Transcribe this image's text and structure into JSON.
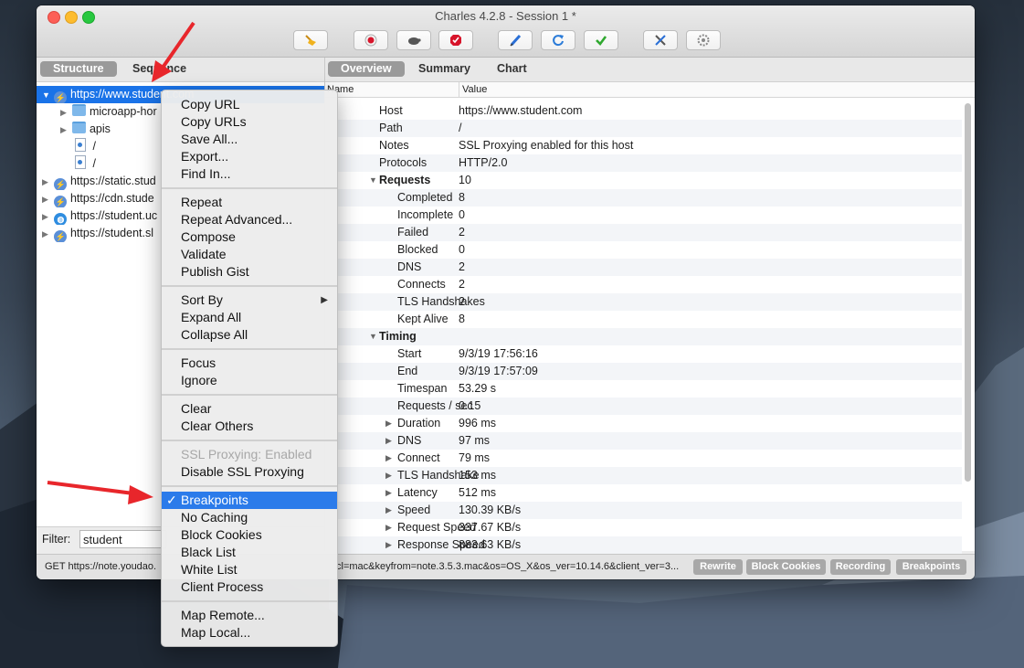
{
  "window": {
    "title": "Charles 4.2.8 - Session 1 *"
  },
  "left_tabs": [
    {
      "label": "Structure"
    },
    {
      "label": "Sequence"
    }
  ],
  "tree": [
    {
      "label": "https://www.student.com",
      "icon": "bolt-icon"
    },
    {
      "label": "microapp-hor",
      "icon": "folder-icon"
    },
    {
      "label": "apis",
      "icon": "folder-icon"
    },
    {
      "label": "/",
      "icon": "document-icon"
    },
    {
      "label": "/",
      "icon": "document-icon"
    },
    {
      "label": "https://static.stud",
      "icon": "bolt-icon"
    },
    {
      "label": "https://cdn.stude",
      "icon": "bolt-icon"
    },
    {
      "label": "https://student.uc",
      "icon": "globe-icon"
    },
    {
      "label": "https://student.sl",
      "icon": "bolt-icon"
    }
  ],
  "filter": {
    "label": "Filter:",
    "value": "student"
  },
  "right_tabs": [
    {
      "label": "Overview"
    },
    {
      "label": "Summary"
    },
    {
      "label": "Chart"
    }
  ],
  "columns": {
    "name": "Name",
    "value": "Value"
  },
  "overview": [
    {
      "name": "Host",
      "value": "https://www.student.com"
    },
    {
      "name": "Path",
      "value": "/"
    },
    {
      "name": "Notes",
      "value": "SSL Proxying enabled for this host"
    },
    {
      "name": "Protocols",
      "value": "HTTP/2.0"
    },
    {
      "name": "Requests",
      "value": "10"
    },
    {
      "name": "Completed",
      "value": "8"
    },
    {
      "name": "Incomplete",
      "value": "0"
    },
    {
      "name": "Failed",
      "value": "2"
    },
    {
      "name": "Blocked",
      "value": "0"
    },
    {
      "name": "DNS",
      "value": "2"
    },
    {
      "name": "Connects",
      "value": "2"
    },
    {
      "name": "TLS Handshakes",
      "value": "2"
    },
    {
      "name": "Kept Alive",
      "value": "8"
    },
    {
      "name": "Timing",
      "value": ""
    },
    {
      "name": "Start",
      "value": "9/3/19 17:56:16"
    },
    {
      "name": "End",
      "value": "9/3/19 17:57:09"
    },
    {
      "name": "Timespan",
      "value": "53.29 s"
    },
    {
      "name": "Requests / sec",
      "value": "0.15"
    },
    {
      "name": "Duration",
      "value": "996 ms"
    },
    {
      "name": "DNS",
      "value": "97 ms"
    },
    {
      "name": "Connect",
      "value": "79 ms"
    },
    {
      "name": "TLS Handshake",
      "value": "153 ms"
    },
    {
      "name": "Latency",
      "value": "512 ms"
    },
    {
      "name": "Speed",
      "value": "130.39 KB/s"
    },
    {
      "name": "Request Speed",
      "value": "337.67 KB/s"
    },
    {
      "name": "Response Speed",
      "value": "883.63 KB/s"
    }
  ],
  "status": {
    "text": "GET https://note.youdao.com/yws/api/personal/sync?method=push&keyfrom=note.3.5.3.mac&os=OS_X&os_ver=10.14.6&client_ver=3...",
    "text_left": "GET https://note.youdao.",
    "text_right": "cl=mac&keyfrom=note.3.5.3.mac&os=OS_X&os_ver=10.14.6&client_ver=3...",
    "buttons": [
      {
        "label": "Rewrite"
      },
      {
        "label": "Block Cookies"
      },
      {
        "label": "Recording"
      },
      {
        "label": "Breakpoints"
      }
    ]
  },
  "context_menu": {
    "items": [
      {
        "label": "Copy URL"
      },
      {
        "label": "Copy URLs"
      },
      {
        "label": "Save All..."
      },
      {
        "label": "Export..."
      },
      {
        "label": "Find In..."
      },
      {
        "label": "Repeat"
      },
      {
        "label": "Repeat Advanced..."
      },
      {
        "label": "Compose"
      },
      {
        "label": "Validate"
      },
      {
        "label": "Publish Gist"
      },
      {
        "label": "Sort By"
      },
      {
        "label": "Expand All"
      },
      {
        "label": "Collapse All"
      },
      {
        "label": "Focus"
      },
      {
        "label": "Ignore"
      },
      {
        "label": "Clear"
      },
      {
        "label": "Clear Others"
      },
      {
        "label": "SSL Proxying: Enabled"
      },
      {
        "label": "Disable SSL Proxying"
      },
      {
        "label": "Breakpoints",
        "checked": true
      },
      {
        "label": "No Caching"
      },
      {
        "label": "Block Cookies"
      },
      {
        "label": "Black List"
      },
      {
        "label": "White List"
      },
      {
        "label": "Client Process"
      },
      {
        "label": "Map Remote..."
      },
      {
        "label": "Map Local..."
      }
    ],
    "check_glyph": "✓",
    "submenu_glyph": "▶"
  },
  "colors": {
    "accent": "#2b7bea",
    "selection": "#1a73e8",
    "annotation_arrow": "#e8262b"
  }
}
